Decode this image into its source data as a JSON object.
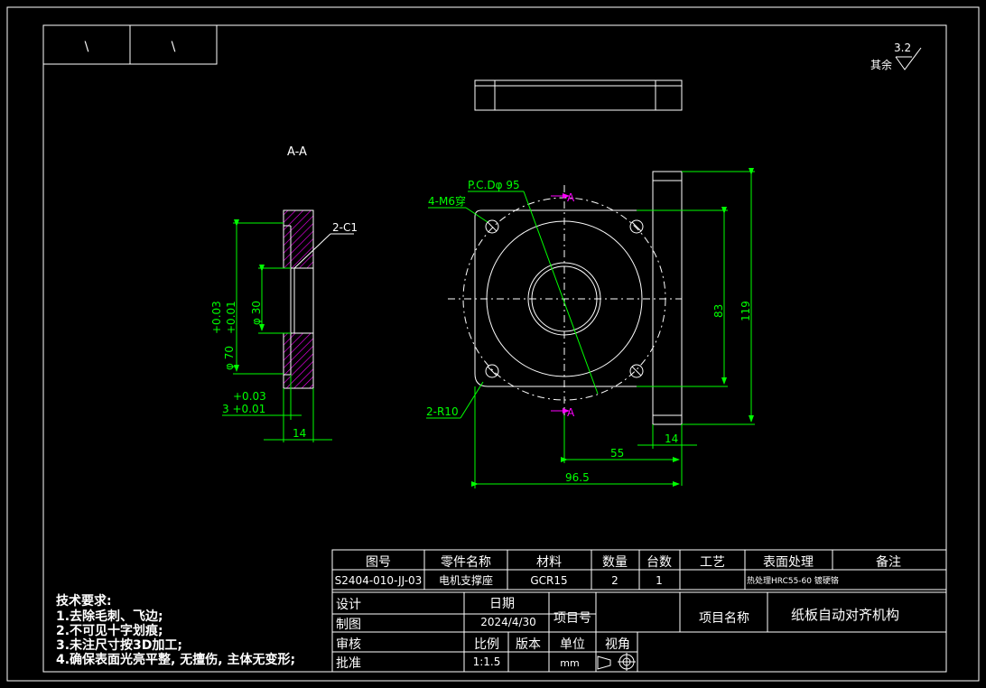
{
  "corner_box": [
    "\\",
    "\\"
  ],
  "roughness": {
    "value": "3.2",
    "label": "其余"
  },
  "section_label": "A-A",
  "dims": {
    "c1": "2-C1",
    "tol_70_up": "+0.03",
    "tol_70_low": "+0.01",
    "d70": "φ 70",
    "d30": "φ 30",
    "tol_3_up": "+0.03",
    "d3": "3 +0.01",
    "w14_left": "14",
    "pcd": "P.C.Dφ 95",
    "holes": "4-M6穿",
    "radius": "2-R10",
    "cut_a": "A",
    "h83": "83",
    "h119": "119",
    "w55": "55",
    "w14_right": "14",
    "w96": "96.5"
  },
  "tech_req": {
    "title": "技术要求:",
    "items": [
      "1.去除毛刺、飞边;",
      "2.不可见十字划痕;",
      "3.未注尺寸按3D加工;",
      "4.确保表面光亮平整, 无擅伤, 主体无变形;"
    ]
  },
  "title_block": {
    "headers": [
      "图号",
      "零件名称",
      "材料",
      "数量",
      "台数",
      "工艺",
      "表面处理",
      "备注"
    ],
    "values": [
      "S2404-010-JJ-03",
      "电机支撑座",
      "GCR15",
      "2",
      "1",
      "",
      "热处理HRC55-60 镀硬铬",
      ""
    ],
    "design": "设计",
    "draw": "制图",
    "check": "审核",
    "approve": "批准",
    "date_label": "日期",
    "date_value": "2024/4/30",
    "project_no": "项目号",
    "project_name_label": "项目名称",
    "project_name": "纸板自动对齐机构",
    "scale_label": "比例",
    "scale_value": "1:1.5",
    "version_label": "版本",
    "unit_label": "单位",
    "unit_value": "mm",
    "view_label": "视角"
  }
}
